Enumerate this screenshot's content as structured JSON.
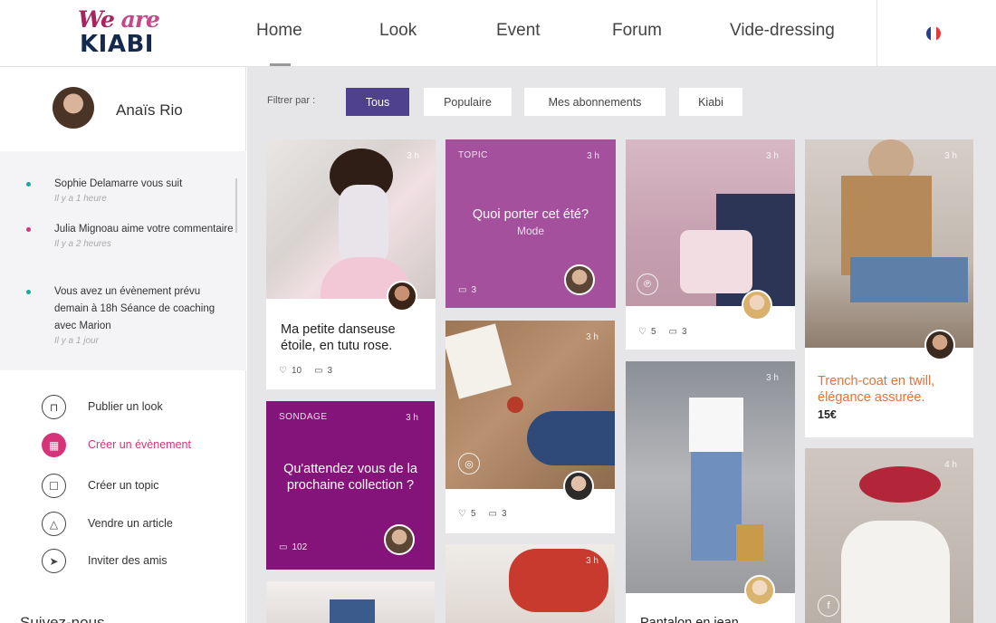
{
  "brand": {
    "line1_a": "We",
    "line1_b": "are",
    "line2": "KIABI"
  },
  "nav": {
    "items": [
      {
        "label": "Home",
        "active": true
      },
      {
        "label": "Look"
      },
      {
        "label": "Event"
      },
      {
        "label": "Forum"
      },
      {
        "label": "Vide-dressing"
      }
    ],
    "language_flag": "fr-flag"
  },
  "profile": {
    "name": "Anaïs Rio"
  },
  "notifications": [
    {
      "text": "Sophie Delamarre vous suit",
      "time": "Il y a 1 heure",
      "dot_color": "#1aa6a6"
    },
    {
      "text": "Julia Mignoau aime votre commentaire",
      "time": "Il y a 2 heures",
      "dot_color": "#d6337a"
    },
    {
      "text": "Vous avez un évènement prévu demain à 18h Séance de coaching avec Marion",
      "time": "Il y a 1 jour",
      "dot_color": "#1aa6a6"
    }
  ],
  "actions": [
    {
      "label": "Publier un look",
      "icon": "hanger-icon"
    },
    {
      "label": "Créer un évènement",
      "icon": "calendar-icon",
      "active": true
    },
    {
      "label": "Créer un topic",
      "icon": "chat-icon"
    },
    {
      "label": "Vendre un article",
      "icon": "tag-icon"
    },
    {
      "label": "Inviter des amis",
      "icon": "send-icon"
    }
  ],
  "follow_title": "Suivez-nous",
  "filter": {
    "label": "Filtrer par :",
    "chips": [
      "Tous",
      "Populaire",
      "Mes abonnements",
      "Kiabi"
    ],
    "active_chip": "Tous"
  },
  "cards": {
    "danseuse": {
      "time": "3 h",
      "caption": "Ma petite danseuse étoile, en tutu rose.",
      "likes": "10",
      "comments": "3"
    },
    "topic": {
      "label": "TOPIC",
      "time": "3 h",
      "title": "Quoi porter cet été?",
      "subtitle": "Mode",
      "comments": "3"
    },
    "sondage": {
      "label": "SONDAGE",
      "time": "3 h",
      "title": "Qu'attendez vous de la prochaine collection ?",
      "comments": "102"
    },
    "book": {
      "time": "3 h",
      "likes": "5",
      "comments": "3"
    },
    "bag": {
      "time": "3 h",
      "likes": "5",
      "comments": "3"
    },
    "jeans": {
      "time": "3 h",
      "caption": "Pantalon en jean"
    },
    "scarf": {
      "time": "3 h"
    },
    "trench": {
      "time": "3 h",
      "caption": "Trench-coat en twill, élégance assurée.",
      "price": "15€"
    },
    "hat": {
      "time": "4 h"
    }
  },
  "colors": {
    "accent_purple": "#4f418e",
    "topic_pink": "#a4509d",
    "sondage_purple": "#84147a",
    "active_pink": "#d6337a",
    "caption_orange": "#e0733a"
  }
}
